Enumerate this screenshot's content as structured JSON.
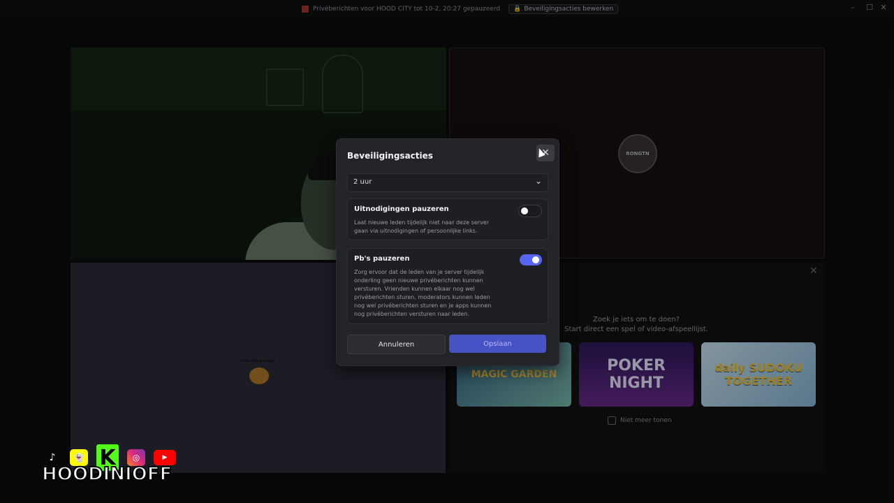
{
  "titlebar": {
    "notice": "Privéberichten voor HOOD CITY tot 10-2, 20:27 gepauzeerd",
    "security_button": "Beveiligingsacties bewerken",
    "minimize": "–",
    "maximize": "☐",
    "close": "✕"
  },
  "stream": {
    "avatar_text": "RONGTN"
  },
  "screen_share": {
    "label": "trust the process"
  },
  "activities": {
    "title": "Zoek je iets om te doen?",
    "subtitle": "Start direct een spel of video-afspeellijst.",
    "cards": [
      "MAGIC GARDEN",
      "POKER NIGHT",
      "daily SUDOKU TOGETHER"
    ],
    "dont_show": "Niet meer tonen"
  },
  "modal": {
    "title": "Beveiligingsacties",
    "duration_value": "2 uur",
    "options": [
      {
        "title": "Uitnodigingen pauzeren",
        "description": "Laat nieuwe leden tijdelijk niet naar deze server gaan via uitnodigingen of persoonlijke links.",
        "enabled": false
      },
      {
        "title": "Pb's pauzeren",
        "description": "Zorg ervoor dat de leden van je server tijdelijk onderling geen nieuwe privéberichten kunnen versturen. Vrienden kunnen elkaar nog wel privéberichten sturen, moderators kunnen leden nog wel privéberichten sturen en je apps kunnen nog privéberichten versturen naar leden.",
        "enabled": true
      }
    ],
    "cancel_label": "Annuleren",
    "save_label": "Opslaan"
  },
  "overlay": {
    "brand": "HOODINIOFF",
    "social_icons": [
      "tiktok-icon",
      "snapchat-icon",
      "kick-icon",
      "instagram-icon",
      "youtube-icon"
    ]
  },
  "colors": {
    "accent": "#5865f2",
    "modal_bg": "#232428",
    "save_button": "#4752c4"
  }
}
